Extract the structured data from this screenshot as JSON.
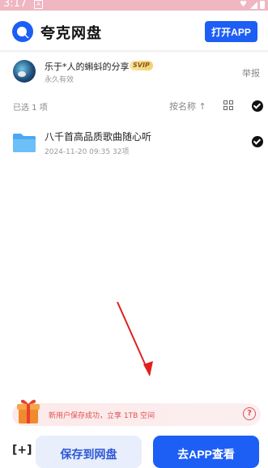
{
  "status_bar": {
    "time": "3:17",
    "notification_letter": "A"
  },
  "header": {
    "app_name": "夸克网盘",
    "open_app_label": "打开APP",
    "accent": "#1d5ef5"
  },
  "sharer": {
    "name": "乐于*人的蝌蚪的分享",
    "badge": "SVIP",
    "validity": "永久有效",
    "report_label": "举报"
  },
  "toolbar": {
    "selected_count": "已选 1 项",
    "sort_label": "按名称"
  },
  "files": [
    {
      "name": "八千首高品质歌曲随心听",
      "date": "2024-11-20 09:35",
      "count": "32项"
    }
  ],
  "promo": {
    "text": "新用户保存成功，立享 1TB 空间"
  },
  "bottom": {
    "bracket_icon_label": "[+]",
    "save_label": "保存到网盘",
    "go_app_label": "去APP查看"
  }
}
